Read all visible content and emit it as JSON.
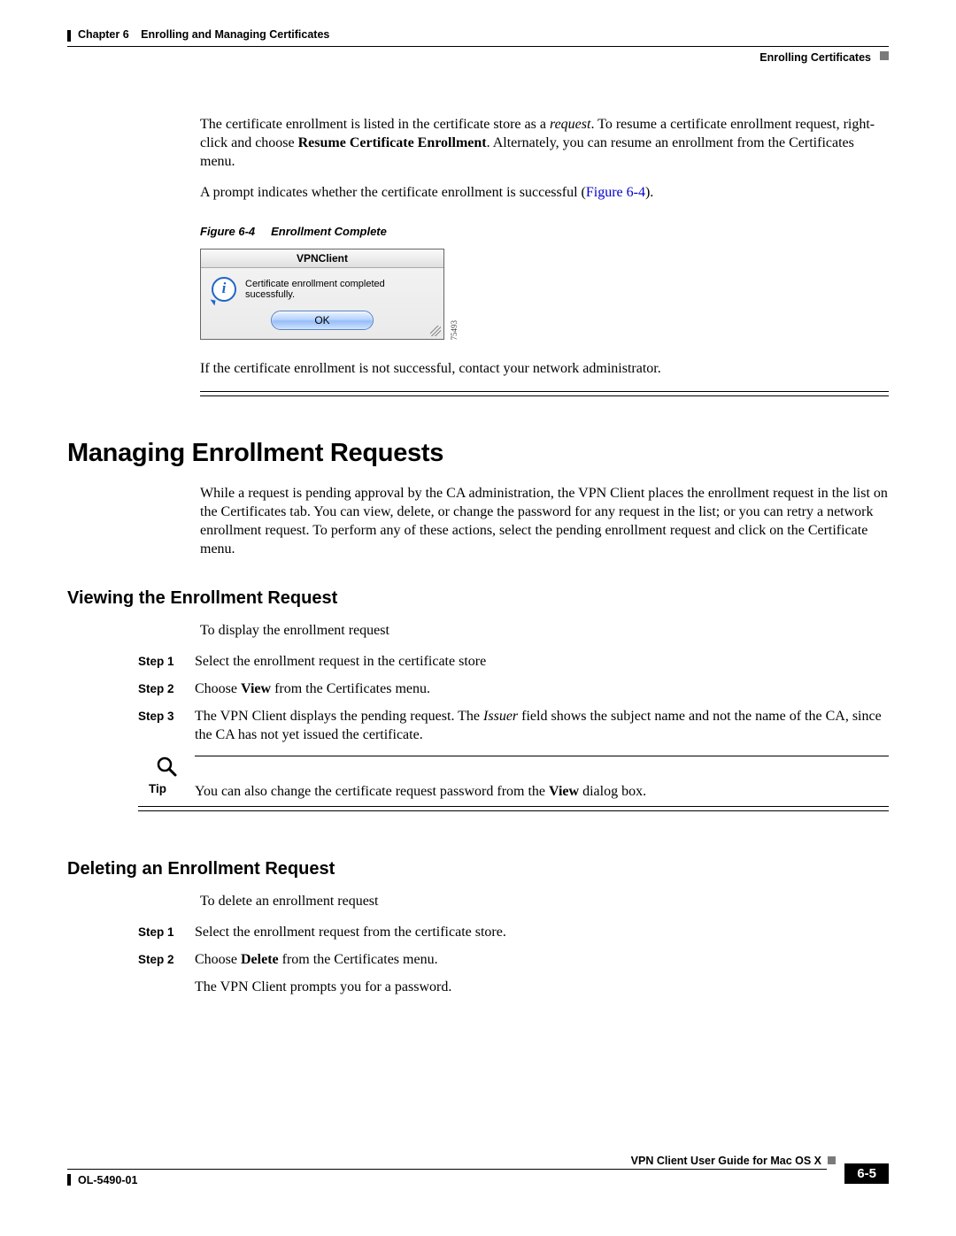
{
  "header": {
    "chapter_prefix": "Chapter 6",
    "chapter_title": "Enrolling and Managing Certificates",
    "section_label": "Enrolling Certificates"
  },
  "intro": {
    "p1_a": "The certificate enrollment is listed in the certificate store as a ",
    "p1_req": "request",
    "p1_b": ". To resume a certificate enrollment request, right-click and choose ",
    "p1_bold": "Resume Certificate Enrollment",
    "p1_c": ". Alternately, you can resume an enrollment from the Certificates menu.",
    "p2_a": "A prompt indicates whether the certificate enrollment is successful (",
    "p2_link": "Figure 6-4",
    "p2_b": ")."
  },
  "figure": {
    "label": "Figure 6-4",
    "caption": "Enrollment Complete",
    "dialog_title": "VPNClient",
    "dialog_msg": "Certificate enrollment completed sucessfully.",
    "ok": "OK",
    "code": "75493"
  },
  "after_fig": "If the certificate enrollment is not successful, contact your network administrator.",
  "sec1": {
    "heading": "Managing Enrollment Requests",
    "para": "While a request is pending approval by the CA administration, the VPN Client places the enrollment request in the list on the Certificates tab. You can view, delete, or change the password for any request in the list; or you can retry a network enrollment request. To perform any of these actions, select the pending enrollment request and click on the Certificate menu."
  },
  "viewing": {
    "heading": "Viewing the Enrollment Request",
    "intro": "To display the enrollment request",
    "steps": [
      {
        "label": "Step 1",
        "text_a": "Select the enrollment request in the certificate store"
      },
      {
        "label": "Step 2",
        "text_a": "Choose ",
        "bold": "View",
        "text_b": " from the Certificates menu."
      },
      {
        "label": "Step 3",
        "text_a": "The VPN Client displays the pending request. The ",
        "ital": "Issuer",
        "text_b": " field shows the subject name and not the name of the CA, since the CA has not yet issued the certificate."
      }
    ],
    "tip_label": "Tip",
    "tip_a": "You can also change the certificate request password from the ",
    "tip_bold": "View",
    "tip_b": " dialog box."
  },
  "deleting": {
    "heading": "Deleting an Enrollment Request",
    "intro": "To delete an enrollment request",
    "steps": [
      {
        "label": "Step 1",
        "text_a": "Select the enrollment request from the certificate store."
      },
      {
        "label": "Step 2",
        "text_a": "Choose ",
        "bold": "Delete",
        "text_b": " from the Certificates menu.",
        "extra": "The VPN Client prompts you for a password."
      }
    ]
  },
  "footer": {
    "guide": "VPN Client User Guide for Mac OS X",
    "docnum": "OL-5490-01",
    "page": "6-5"
  }
}
